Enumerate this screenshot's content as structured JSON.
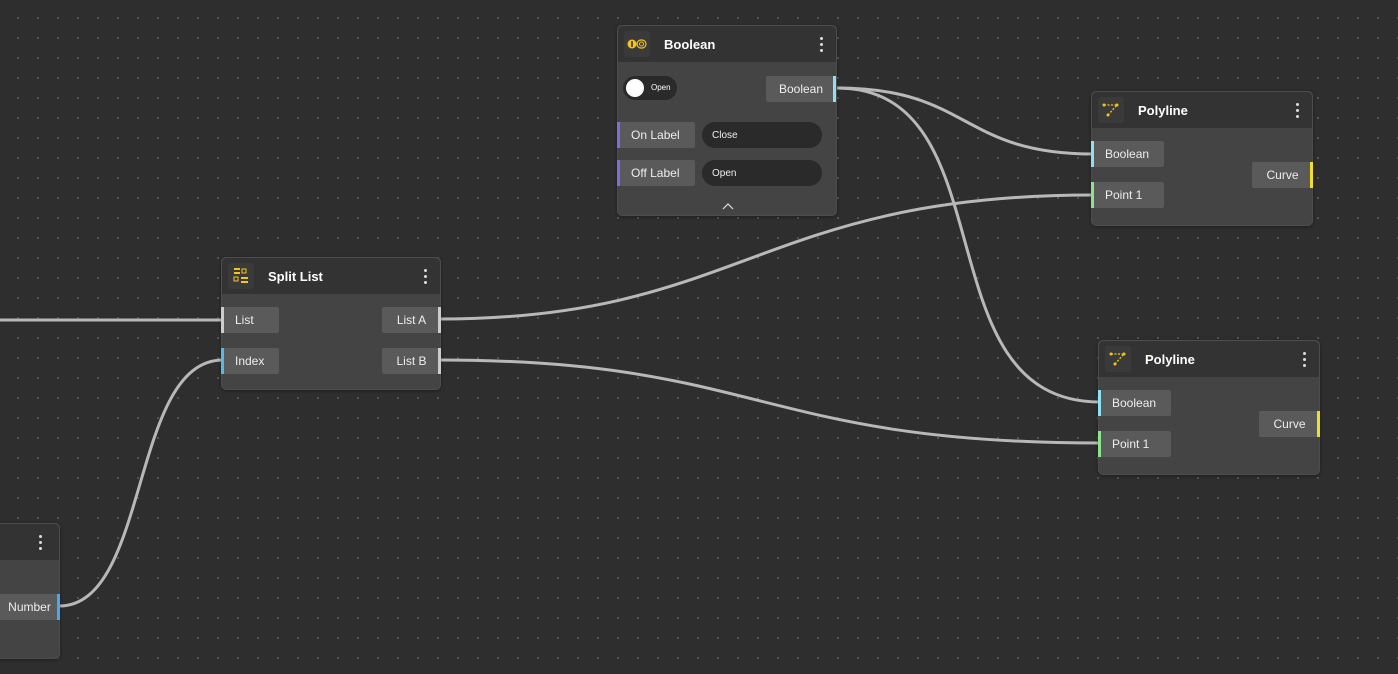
{
  "nodes": {
    "boolean": {
      "title": "Boolean",
      "toggle_label": "Open",
      "output": "Boolean",
      "on_label": {
        "label": "On Label",
        "value": "Close"
      },
      "off_label": {
        "label": "Off Label",
        "value": "Open"
      },
      "icon": "boolean-toggle-icon",
      "collapse_icon": "chevron-up-icon"
    },
    "split_list": {
      "title": "Split List",
      "inputs": [
        "List",
        "Index"
      ],
      "outputs": [
        "List A",
        "List B"
      ],
      "icon": "split-list-icon"
    },
    "polyline_top": {
      "title": "Polyline",
      "inputs": [
        "Boolean",
        "Point 1"
      ],
      "output": "Curve",
      "icon": "polyline-icon"
    },
    "polyline_bottom": {
      "title": "Polyline",
      "inputs": [
        "Boolean",
        "Point 1"
      ],
      "output": "Curve",
      "icon": "polyline-icon"
    },
    "number": {
      "output": "Number"
    }
  },
  "colors": {
    "canvas": "#2e2e2e",
    "wire": "#b8b8b8",
    "boolean_port": "#8fe0f0",
    "point_port": "#8fe08f",
    "curve_port": "#f0e020",
    "label_port": "#7a6ee0",
    "index_port": "#58b8e8",
    "icon_accent": "#f5c518"
  }
}
